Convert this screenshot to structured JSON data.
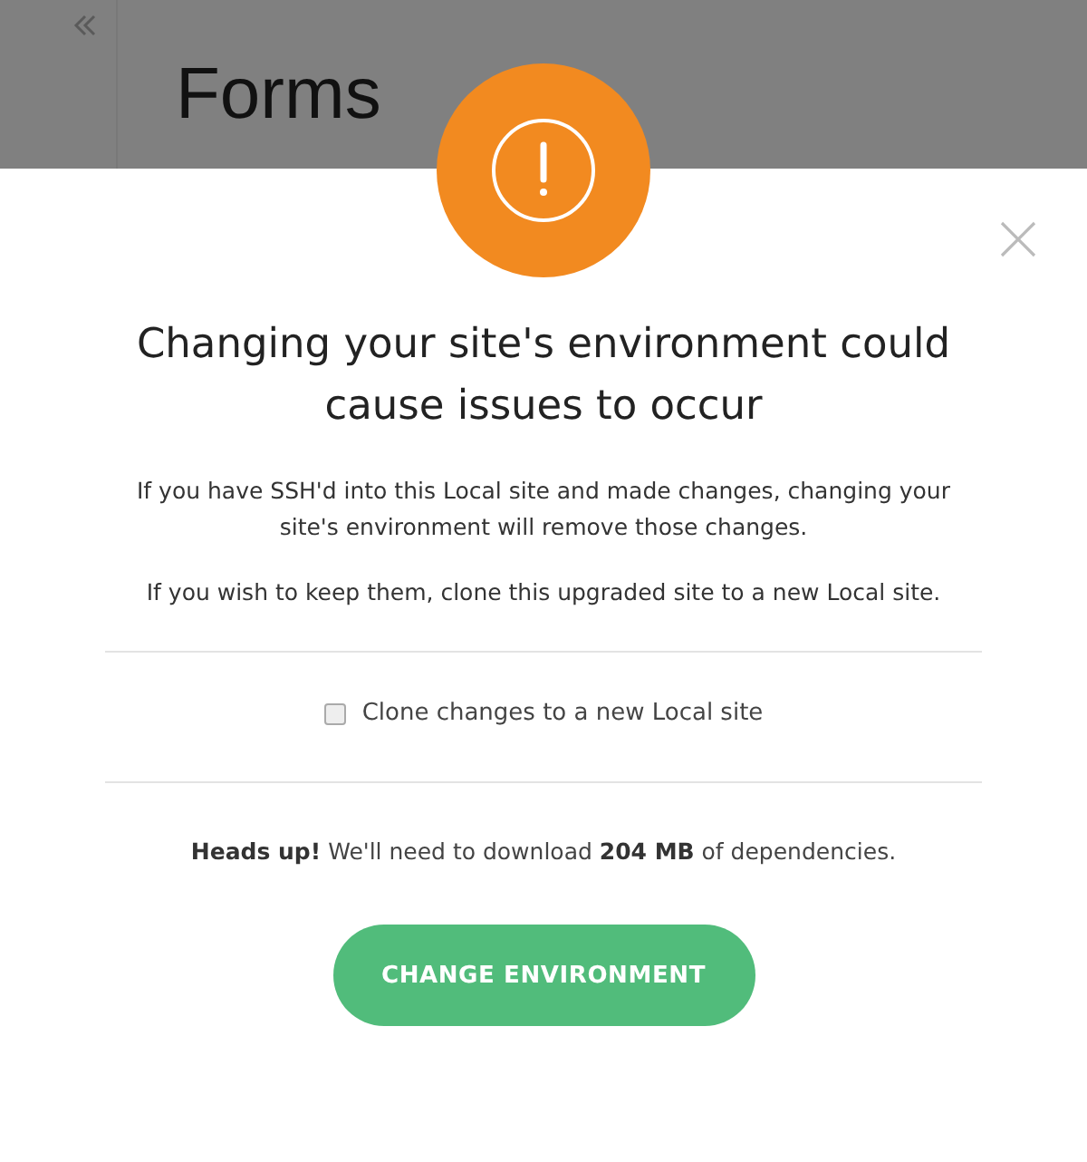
{
  "background": {
    "page_title": "Forms"
  },
  "dialog": {
    "title": "Changing your site's environment could cause issues to occur",
    "paragraphs": [
      "If you have SSH'd into this Local site and made changes, changing your site's environment will remove those changes.",
      "If you wish to keep them, clone this upgraded site to a new Local site."
    ],
    "checkbox": {
      "label": "Clone changes to a new Local site",
      "checked": false
    },
    "notice": "**Heads up!** We'll need to download **204 MB** of dependencies.",
    "button": "CHANGE ENVIRONMENT"
  }
}
